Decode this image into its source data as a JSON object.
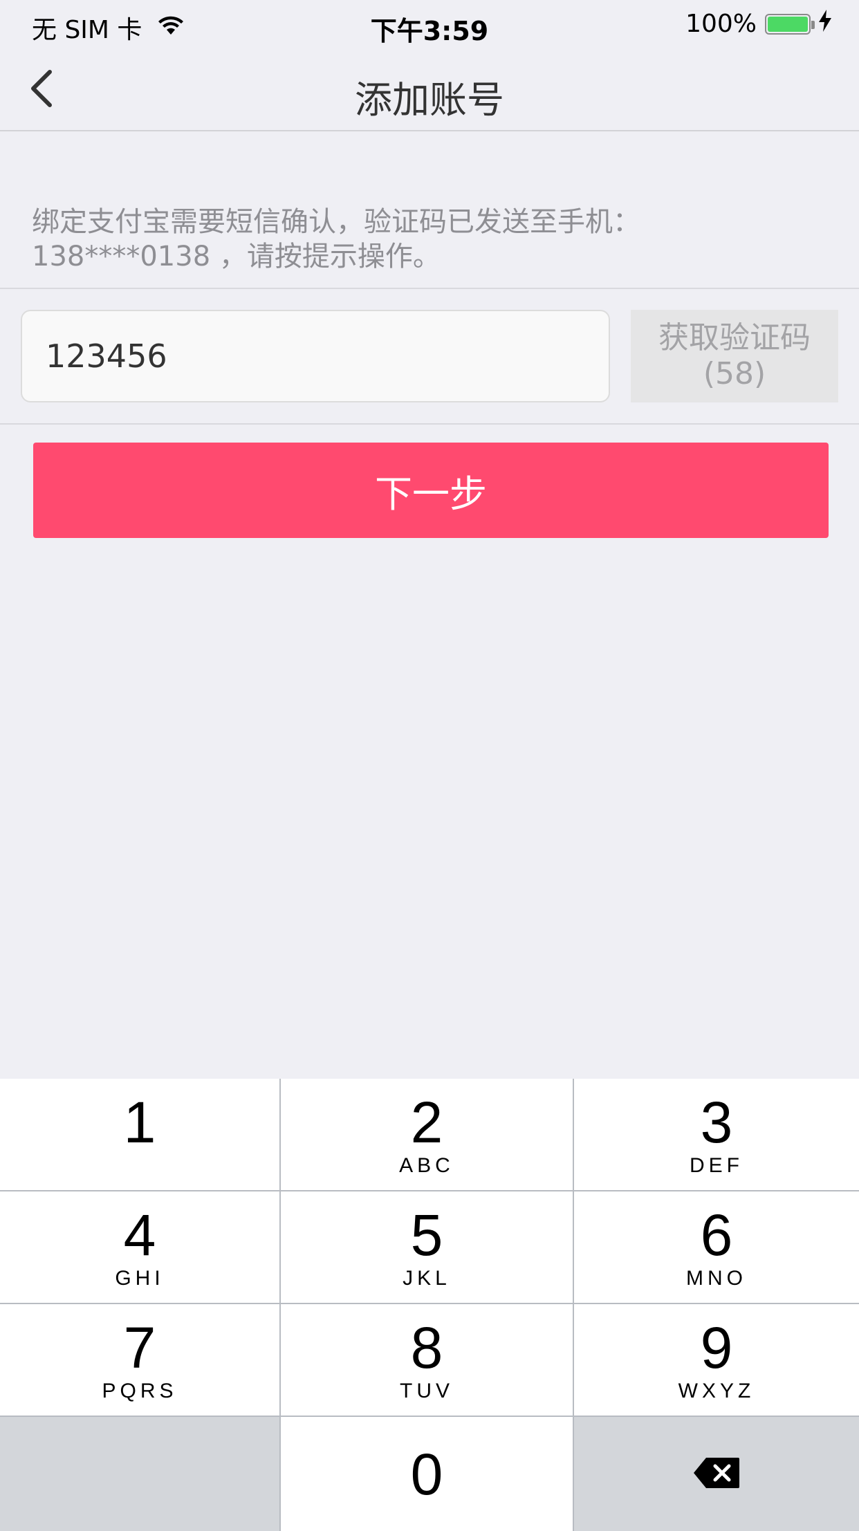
{
  "status_bar": {
    "carrier": "无 SIM 卡",
    "time": "下午3:59",
    "battery": "100%",
    "battery_level": 1.0,
    "battery_color": "#4cd964"
  },
  "nav": {
    "back_icon": "chevron-left-icon",
    "title": "添加账号"
  },
  "hint": {
    "line1": "绑定支付宝需要短信确认，验证码已发送至手机：",
    "line2": "138****0138 ，请按提示操作。"
  },
  "code_input": {
    "value": "123456",
    "placeholder": ""
  },
  "get_code_button": {
    "label": "获取验证码",
    "countdown": "(58)"
  },
  "next_button": {
    "label": "下一步",
    "color": "#ff4a6f"
  },
  "keypad": {
    "keys": [
      {
        "num": "1",
        "letters": ""
      },
      {
        "num": "2",
        "letters": "ABC"
      },
      {
        "num": "3",
        "letters": "DEF"
      },
      {
        "num": "4",
        "letters": "GHI"
      },
      {
        "num": "5",
        "letters": "JKL"
      },
      {
        "num": "6",
        "letters": "MNO"
      },
      {
        "num": "7",
        "letters": "PQRS"
      },
      {
        "num": "8",
        "letters": "TUV"
      },
      {
        "num": "9",
        "letters": "WXYZ"
      },
      {
        "num": "0",
        "letters": ""
      }
    ],
    "delete_icon": "backspace-icon"
  }
}
